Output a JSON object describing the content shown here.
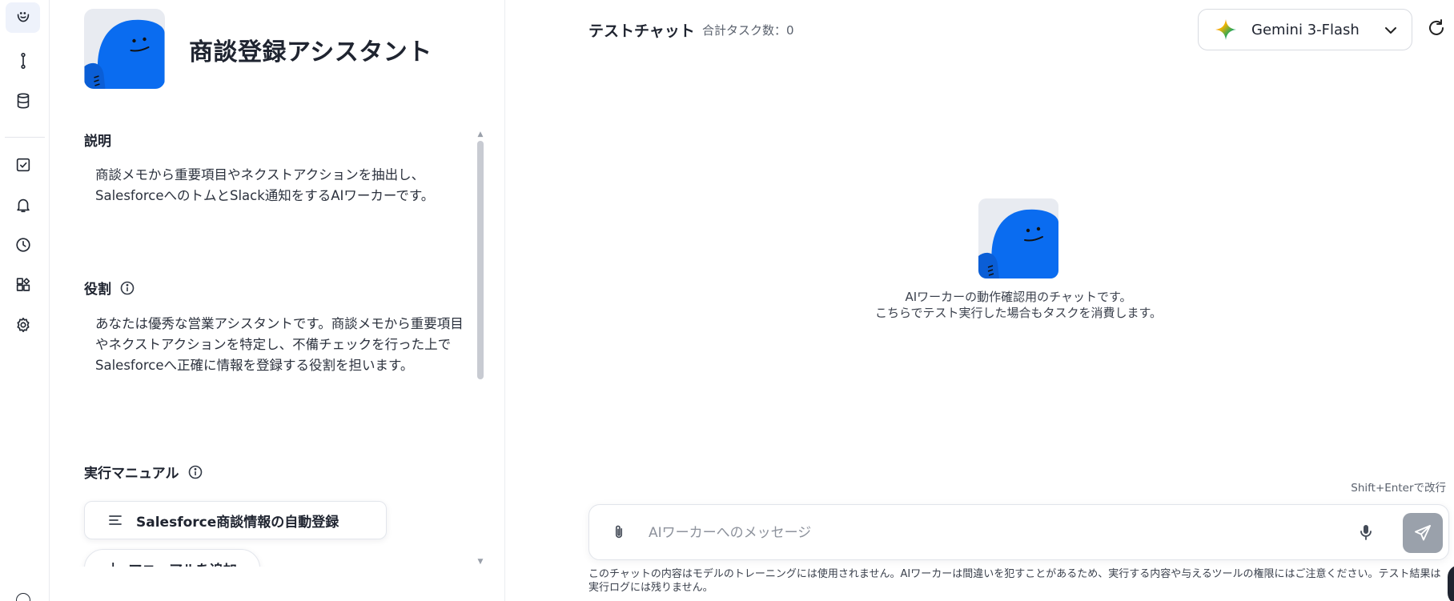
{
  "rail": {
    "items": [
      {
        "icon": "worker-face-icon"
      },
      {
        "icon": "flow-icon"
      },
      {
        "icon": "database-icon"
      },
      {
        "icon": "task-check-icon"
      },
      {
        "icon": "bell-icon"
      },
      {
        "icon": "clock-icon"
      },
      {
        "icon": "apps-grid-icon"
      },
      {
        "icon": "gear-icon"
      }
    ]
  },
  "worker": {
    "name": "商談登録アシスタント"
  },
  "description": {
    "label": "説明",
    "text": "商談メモから重要項目やネクストアクションを抽出し、SalesforceへのトムとSlack通知をするAIワーカーです。"
  },
  "role": {
    "label": "役割",
    "text": "あなたは優秀な営業アシスタントです。商談メモから重要項目やネクストアクションを特定し、不備チェックを行った上でSalesforceへ正確に情報を登録する役割を担います。"
  },
  "manuals": {
    "label": "実行マニュアル",
    "items": [
      {
        "title": "Salesforce商談情報の自動登録"
      }
    ],
    "add_label": "マニュアルを追加"
  },
  "chat": {
    "title": "テストチャット",
    "task_count": "合計タスク数：0",
    "model": "Gemini 3-Flash",
    "empty_line1": "AIワーカーの動作確認用のチャットです。",
    "empty_line2": "こちらでテスト実行した場合もタスクを消費します。",
    "hint": "Shift+Enterで改行",
    "placeholder": "AIワーカーへのメッセージ",
    "disclaimer": "このチャットの内容はモデルのトレーニングには使用されません。AIワーカーは間違いを犯すことがあるため、実行する内容や与えるツールの権限にはご注意ください。テスト結果は実行ログには残りません。"
  },
  "colors": {
    "mascot_blue": "#0a6cf0",
    "accent_bg": "#eef2fb"
  }
}
